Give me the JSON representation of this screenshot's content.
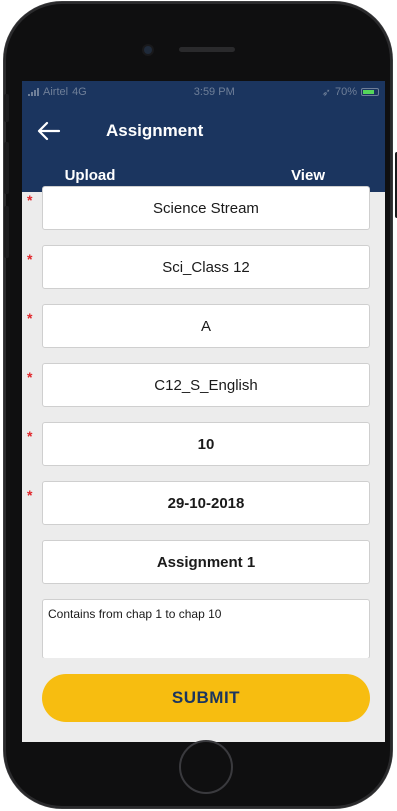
{
  "status_bar": {
    "carrier": "Airtel",
    "network": "4G",
    "time": "3:59 PM",
    "battery": "70%"
  },
  "app_bar": {
    "title": "Assignment",
    "back_icon": "arrow-left-icon"
  },
  "tabs": [
    {
      "label": "Upload",
      "active": true
    },
    {
      "label": "View",
      "active": false
    }
  ],
  "form": {
    "fields": [
      {
        "value": "Science Stream",
        "required": true,
        "bold": false
      },
      {
        "value": "Sci_Class 12",
        "required": true,
        "bold": false
      },
      {
        "value": "A",
        "required": true,
        "bold": false
      },
      {
        "value": "C12_S_English",
        "required": true,
        "bold": false
      },
      {
        "value": "10",
        "required": true,
        "bold": true
      },
      {
        "value": "29-10-2018",
        "required": true,
        "bold": true
      },
      {
        "value": "Assignment 1",
        "required": false,
        "bold": true
      }
    ],
    "required_marker": "*",
    "description": "Contains from chap 1 to chap 10"
  },
  "submit_label": "SUBMIT",
  "colors": {
    "header": "#1b355f",
    "accent": "#f7bd10",
    "required": "#e0262b",
    "background": "#ececec"
  }
}
